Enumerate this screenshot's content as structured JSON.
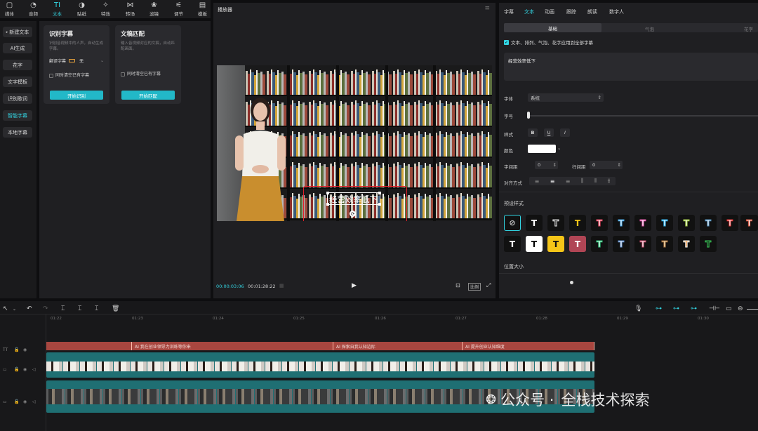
{
  "toolbar": {
    "items": [
      {
        "label": "媒体",
        "icon": "▢"
      },
      {
        "label": "音频",
        "icon": "◔"
      },
      {
        "label": "文本",
        "icon": "TI"
      },
      {
        "label": "贴纸",
        "icon": "◑"
      },
      {
        "label": "特效",
        "icon": "✧"
      },
      {
        "label": "转场",
        "icon": "⋈"
      },
      {
        "label": "滤镜",
        "icon": "❀"
      },
      {
        "label": "调节",
        "icon": "⚟"
      },
      {
        "label": "模板",
        "icon": "▤"
      }
    ]
  },
  "leftnav": {
    "items": [
      "新建文本",
      "AI生成",
      "花字",
      "文字模板",
      "识别歌词",
      "智能字幕",
      "本地字幕"
    ]
  },
  "cards": [
    {
      "title": "识别字幕",
      "desc": "识别音视频中的人声，自动生成字幕。",
      "translate_label": "翻译字幕",
      "translate_value": "无",
      "clear_label": "同时清空已有字幕",
      "button": "开始识别"
    },
    {
      "title": "文稿匹配",
      "desc": "输入音视频对应的文稿，自动匹配画面。",
      "clear_label": "同时清空已有字幕",
      "button": "开始匹配"
    }
  ],
  "player": {
    "title": "播放器",
    "time_current": "00:00:03:06",
    "time_total": "00:01:28:22",
    "ratio_label": "比例",
    "subtitle": "经营效率低下"
  },
  "right": {
    "tabs": [
      "字幕",
      "文本",
      "动画",
      "跟踪",
      "朗读",
      "数字人"
    ],
    "subtabs": [
      "基础",
      "气泡",
      "花字"
    ],
    "apply_all": "文本、排列、气泡、花字应用到全部字幕",
    "text_value": "经营效率低下",
    "font_label": "字体",
    "font_value": "系统",
    "size_label": "字号",
    "style_label": "样式",
    "bold": "B",
    "underline": "U",
    "italic": "I",
    "color_label": "颜色",
    "spacing_label": "字间距",
    "spacing_value": "0",
    "line_spacing_label": "行间距",
    "line_spacing_value": "0",
    "align_label": "对齐方式",
    "preset_label": "预设样式",
    "position_label": "位置大小",
    "style_tile_text": "T"
  },
  "timeline": {
    "ticks": [
      "01:22",
      "01:23",
      "01:24",
      "01:25",
      "01:26",
      "01:27",
      "01:28",
      "01:29",
      "01:30"
    ],
    "clips": [
      "AI 我在创业领导力训练等你来",
      "AI 探索自我认知边际",
      "AI 提升创业认知维度"
    ]
  },
  "watermark": {
    "prefix": "公众号 ·",
    "name": "全栈技术探索"
  },
  "colors": {
    "accent": "#33d5e3",
    "clip": "#a8463f",
    "highlight": "#e0202a"
  }
}
